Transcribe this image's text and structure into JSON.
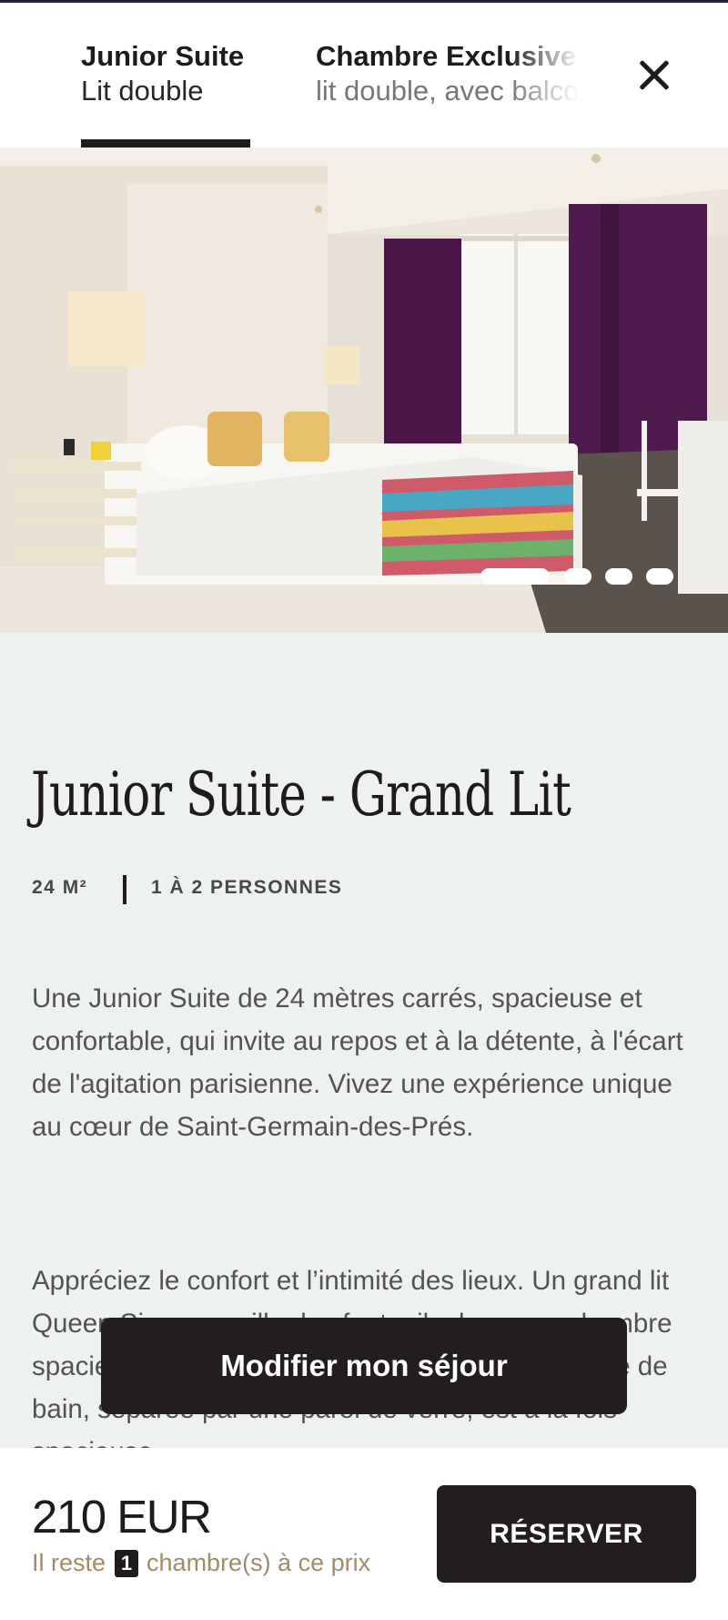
{
  "tabs": [
    {
      "title": "Junior Suite",
      "subtitle": "Lit double",
      "active": true
    },
    {
      "title": "Chambre Exclusive",
      "subtitle": "lit double, avec balcon",
      "active": false
    }
  ],
  "header": {
    "close_icon": "close-icon"
  },
  "gallery": {
    "slide_count": 4,
    "active_slide": 1
  },
  "room": {
    "title": "Junior Suite - Grand Lit",
    "area": "24 M²",
    "capacity": "1 À 2 PERSONNES",
    "description_1": "Une Junior Suite de 24 mètres carrés, spacieuse et confortable, qui invite au repos et à la détente, à l'écart de l'agitation parisienne. Vivez une expérience unique au cœur de Saint-Germain-des-Prés.",
    "description_2": "Appréciez le confort et l’intimité des lieux. Un grand lit Queen Size accueille des fauteuils dans une chambre spacieuse, au décor lumineuse et feutrée. La salle de bain, séparée par une paroi de verre, est à la fois spacieuse"
  },
  "actions": {
    "modify_label": "Modifier mon séjour",
    "reserve_label": "RÉSERVER"
  },
  "pricing": {
    "price": "210 EUR",
    "availability_prefix": "Il reste",
    "availability_count": "1",
    "availability_suffix": "chambre(s) à ce prix"
  },
  "colors": {
    "accent_dark": "#221e1f",
    "availability_gold": "#a48b68",
    "content_bg": "#eef1f2"
  }
}
